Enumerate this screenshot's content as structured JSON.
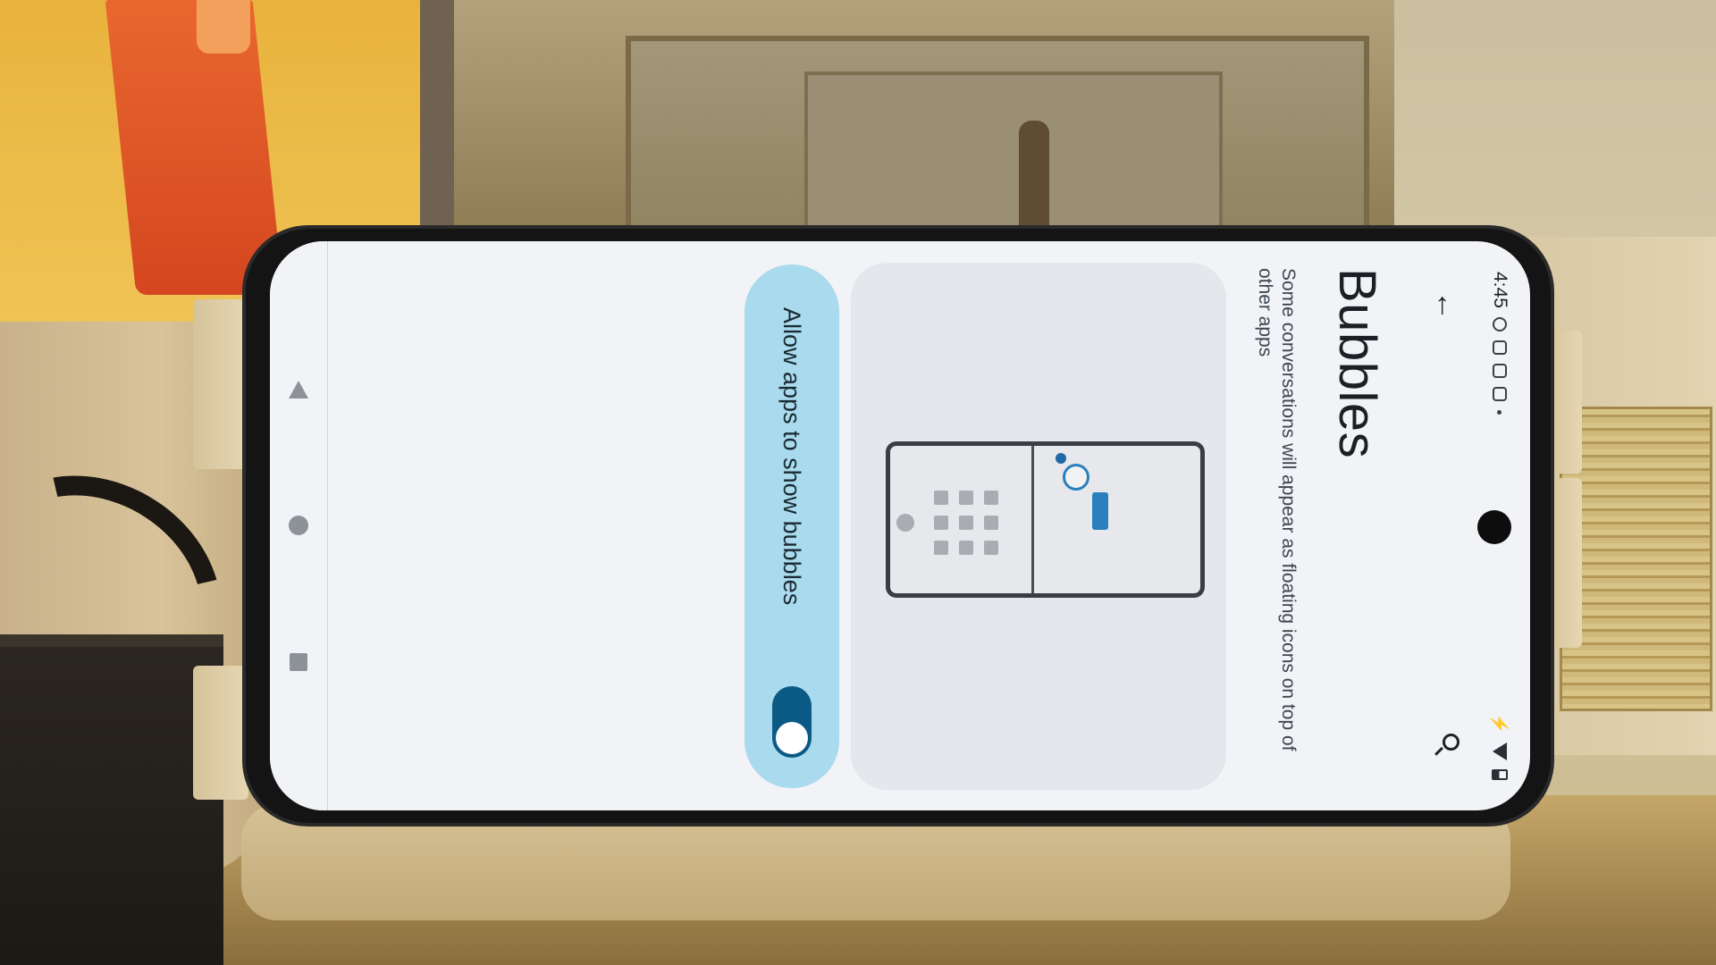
{
  "status_bar": {
    "time": "4:45"
  },
  "app_bar": {
    "back_icon": "arrow-left-icon",
    "search_icon": "search-icon"
  },
  "page": {
    "title": "Bubbles",
    "description": "Some conversations will appear as floating icons on top of other apps"
  },
  "toggle": {
    "label": "Allow apps to show bubbles",
    "checked": true
  },
  "navigation_bar": {
    "back_icon": "nav-back-icon",
    "home_icon": "nav-home-icon",
    "recents_icon": "nav-recents-icon"
  },
  "colors": {
    "toggle_card": "#a9daed",
    "toggle_track": "#0b5a85",
    "accent": "#2b7fbd"
  }
}
